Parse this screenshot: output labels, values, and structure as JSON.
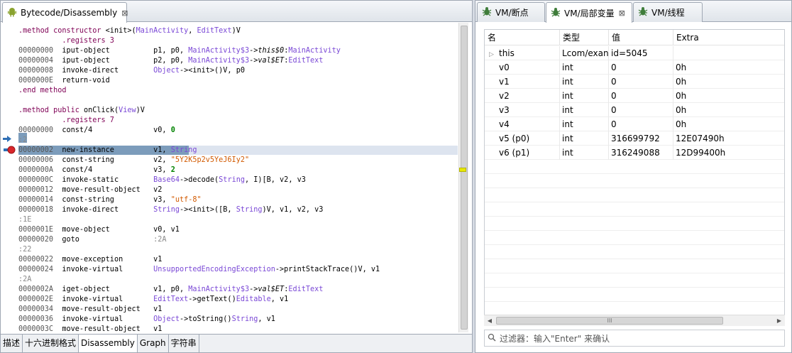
{
  "left_panel": {
    "tab_title": "Bytecode/Disassembly",
    "close_glyph": "⊠",
    "bottom_tabs": [
      "描述",
      "十六进制格式",
      "Disassembly",
      "Graph",
      "字符串"
    ],
    "active_bottom_tab": 2
  },
  "code_lines": [
    [
      [
        "dir",
        ".method constructor "
      ],
      [
        "",
        "<init>("
      ],
      [
        "cls",
        "MainActivity"
      ],
      [
        "",
        ", "
      ],
      [
        "cls",
        "EditText"
      ],
      [
        "",
        ")V"
      ]
    ],
    [
      [
        "",
        "          "
      ],
      [
        "dir",
        ".registers 3"
      ]
    ],
    [
      [
        "addr",
        "00000000  "
      ],
      [
        "",
        "iput-object          p1, p0, "
      ],
      [
        "cls",
        "MainActivity$3"
      ],
      [
        "",
        "->"
      ],
      [
        "fld",
        "this$0"
      ],
      [
        "",
        ":"
      ],
      [
        "cls",
        "MainActivity"
      ]
    ],
    [
      [
        "addr",
        "00000004  "
      ],
      [
        "",
        "iput-object          p2, p0, "
      ],
      [
        "cls",
        "MainActivity$3"
      ],
      [
        "",
        "->"
      ],
      [
        "fld",
        "val$ET"
      ],
      [
        "",
        ":"
      ],
      [
        "cls",
        "EditText"
      ]
    ],
    [
      [
        "addr",
        "00000008  "
      ],
      [
        "",
        "invoke-direct        "
      ],
      [
        "cls",
        "Object"
      ],
      [
        "",
        "-><init>()V, p0"
      ]
    ],
    [
      [
        "addr",
        "0000000E  "
      ],
      [
        "",
        "return-void"
      ]
    ],
    [
      [
        "dir",
        ".end method"
      ]
    ],
    [],
    [
      [
        "dir",
        ".method public "
      ],
      [
        "",
        "onClick("
      ],
      [
        "cls",
        "View"
      ],
      [
        "",
        ")V"
      ]
    ],
    [
      [
        "",
        "          "
      ],
      [
        "dir",
        ".registers 7"
      ]
    ],
    [
      [
        "addr",
        "00000000  "
      ],
      [
        "",
        "const/4              v0, "
      ],
      [
        "num",
        "0"
      ]
    ],
    [
      [
        "lbl",
        ":2"
      ]
    ],
    [
      [
        "addr",
        "00000002  "
      ],
      [
        "",
        "new-instance         v1, "
      ],
      [
        "cls",
        "String"
      ]
    ],
    [
      [
        "addr",
        "00000006  "
      ],
      [
        "",
        "const-string         v2, "
      ],
      [
        "strv",
        "\"5Y2K5p2v5YeJ6Iy2\""
      ]
    ],
    [
      [
        "addr",
        "0000000A  "
      ],
      [
        "",
        "const/4              v3, "
      ],
      [
        "num",
        "2"
      ]
    ],
    [
      [
        "addr",
        "0000000C  "
      ],
      [
        "",
        "invoke-static        "
      ],
      [
        "cls",
        "Base64"
      ],
      [
        "",
        "->decode("
      ],
      [
        "cls",
        "String"
      ],
      [
        "",
        ", I)[B, v2, v3"
      ]
    ],
    [
      [
        "addr",
        "00000012  "
      ],
      [
        "",
        "move-result-object   v2"
      ]
    ],
    [
      [
        "addr",
        "00000014  "
      ],
      [
        "",
        "const-string         v3, "
      ],
      [
        "strv",
        "\"utf-8\""
      ]
    ],
    [
      [
        "addr",
        "00000018  "
      ],
      [
        "",
        "invoke-direct        "
      ],
      [
        "cls",
        "String"
      ],
      [
        "",
        "-><init>([B, "
      ],
      [
        "cls",
        "String"
      ],
      [
        "",
        ")V, v1, v2, v3"
      ]
    ],
    [
      [
        "lbl",
        ":1E"
      ]
    ],
    [
      [
        "addr",
        "0000001E  "
      ],
      [
        "",
        "move-object          v0, v1"
      ]
    ],
    [
      [
        "addr",
        "00000020  "
      ],
      [
        "",
        "goto                 "
      ],
      [
        "lbl",
        ":2A"
      ]
    ],
    [
      [
        "lbl",
        ":22"
      ]
    ],
    [
      [
        "addr",
        "00000022  "
      ],
      [
        "",
        "move-exception       v1"
      ]
    ],
    [
      [
        "addr",
        "00000024  "
      ],
      [
        "",
        "invoke-virtual       "
      ],
      [
        "cls",
        "UnsupportedEncodingException"
      ],
      [
        "",
        "->printStackTrace()V, v1"
      ]
    ],
    [
      [
        "lbl",
        ":2A"
      ]
    ],
    [
      [
        "addr",
        "0000002A  "
      ],
      [
        "",
        "iget-object          v1, p0, "
      ],
      [
        "cls",
        "MainActivity$3"
      ],
      [
        "",
        "->"
      ],
      [
        "fld",
        "val$ET"
      ],
      [
        "",
        ":"
      ],
      [
        "cls",
        "EditText"
      ]
    ],
    [
      [
        "addr",
        "0000002E  "
      ],
      [
        "",
        "invoke-virtual       "
      ],
      [
        "cls",
        "EditText"
      ],
      [
        "",
        "->getText()"
      ],
      [
        "cls",
        "Editable"
      ],
      [
        "",
        ", v1"
      ]
    ],
    [
      [
        "addr",
        "00000034  "
      ],
      [
        "",
        "move-result-object   v1"
      ]
    ],
    [
      [
        "addr",
        "00000036  "
      ],
      [
        "",
        "invoke-virtual       "
      ],
      [
        "cls",
        "Object"
      ],
      [
        "",
        "->toString()"
      ],
      [
        "cls",
        "String"
      ],
      [
        "",
        ", v1"
      ]
    ],
    [
      [
        "addr",
        "0000003C  "
      ],
      [
        "",
        "move-result-object   v1"
      ]
    ]
  ],
  "right_panel": {
    "tabs": [
      {
        "label": "VM/断点",
        "active": false
      },
      {
        "label": "VM/局部变量",
        "active": true
      },
      {
        "label": "VM/线程",
        "active": false
      }
    ],
    "columns": [
      "名",
      "类型",
      "值",
      "Extra"
    ],
    "rows": [
      {
        "name": "this",
        "type": "Lcom/exan",
        "value": "id=5045",
        "extra": "",
        "expander": "▷"
      },
      {
        "name": "v0",
        "type": "int",
        "value": "0",
        "extra": "0h",
        "expander": ""
      },
      {
        "name": "v1",
        "type": "int",
        "value": "0",
        "extra": "0h",
        "expander": ""
      },
      {
        "name": "v2",
        "type": "int",
        "value": "0",
        "extra": "0h",
        "expander": ""
      },
      {
        "name": "v3",
        "type": "int",
        "value": "0",
        "extra": "0h",
        "expander": ""
      },
      {
        "name": "v4",
        "type": "int",
        "value": "0",
        "extra": "0h",
        "expander": ""
      },
      {
        "name": "v5 (p0)",
        "type": "int",
        "value": "316699792",
        "extra": "12E07490h",
        "expander": ""
      },
      {
        "name": "v6 (p1)",
        "type": "int",
        "value": "316249088",
        "extra": "12D99400h",
        "expander": ""
      }
    ],
    "filter_placeholder": "过滤器：输入\"Enter\" 来确认",
    "hscroll_grip": "III"
  },
  "colors": {
    "highlight": "#7c9cbb",
    "breakpoint": "#d9262a",
    "arrow": "#2f6fb5"
  },
  "icons": {
    "android": "android-icon",
    "bug": "bug-icon",
    "breakpoint": "breakpoint-icon",
    "current_line": "current-line-arrow-icon",
    "filter": "search-icon"
  }
}
